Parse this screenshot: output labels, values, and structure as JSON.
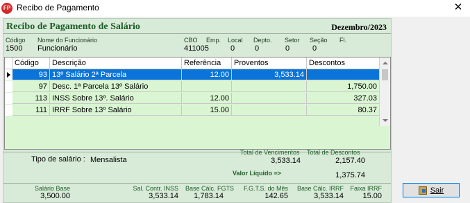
{
  "window": {
    "title": "Recibo de Pagamento",
    "app_icon": "FP",
    "close_glyph": "✕"
  },
  "header": {
    "title": "Recibo de Pagamento de Salário",
    "period": "Dezembro/2023"
  },
  "employee": {
    "codigo_label": "Código",
    "codigo": "1500",
    "nome_label": "Nome do Funcionário",
    "nome": "Funcionário",
    "cbo_label": "CBO",
    "cbo": "411005",
    "emp_label": "Emp.",
    "local_label": "Local",
    "local": "0",
    "depto_label": "Depto.",
    "depto": "0",
    "setor_label": "Setor",
    "setor": "0",
    "secao_label": "Seção",
    "secao": "0",
    "fl_label": "Fl."
  },
  "grid": {
    "columns": [
      "Código",
      "Descrição",
      "Referência",
      "Proventos",
      "Descontos"
    ],
    "rows": [
      {
        "codigo": "93",
        "descricao": "13º Salário 2ª Parcela",
        "referencia": "12.00",
        "proventos": "3,533.14",
        "descontos": "",
        "selected": true
      },
      {
        "codigo": "97",
        "descricao": "Desc. 1ª Parcela 13º Salário",
        "referencia": "",
        "proventos": "",
        "descontos": "1,750.00",
        "selected": false
      },
      {
        "codigo": "113",
        "descricao": "INSS Sobre 13º. Salário",
        "referencia": "12.00",
        "proventos": "",
        "descontos": "327.03",
        "selected": false
      },
      {
        "codigo": "111",
        "descricao": "IRRF Sobre 13º Salário",
        "referencia": "15.00",
        "proventos": "",
        "descontos": "80.37",
        "selected": false
      }
    ]
  },
  "summary": {
    "tipo_label": "Tipo de salário :",
    "tipo_value": "Mensalista",
    "total_vencimentos_label": "Total de Vencimentos",
    "total_vencimentos": "3,533.14",
    "total_descontos_label": "Total de Descontos",
    "total_descontos": "2,157.40",
    "liquido_label": "Valor Líquido  =>",
    "liquido": "1,375.74"
  },
  "bases": {
    "salario_base_label": "Salário Base",
    "salario_base": "3,500.00",
    "sal_contr_inss_label": "Sal. Contr. INSS",
    "sal_contr_inss": "3,533.14",
    "base_fgts_label": "Base Cálc. FGTS",
    "base_fgts": "1,783.14",
    "fgts_mes_label": "F.G.T.S. do Mês",
    "fgts_mes": "142.65",
    "base_irrf_label": "Base Cálc. IRRF",
    "base_irrf": "3,533.14",
    "faixa_irrf_label": "Faixa IRRF",
    "faixa_irrf": "15.00"
  },
  "actions": {
    "sair_label": "Sair",
    "sair_icon": "exit-door-icon"
  },
  "colors": {
    "header_green": "#1f5e27",
    "panel": "#d8ead8",
    "grid_row": "#d9f5d2",
    "selection": "#0a74d8"
  }
}
